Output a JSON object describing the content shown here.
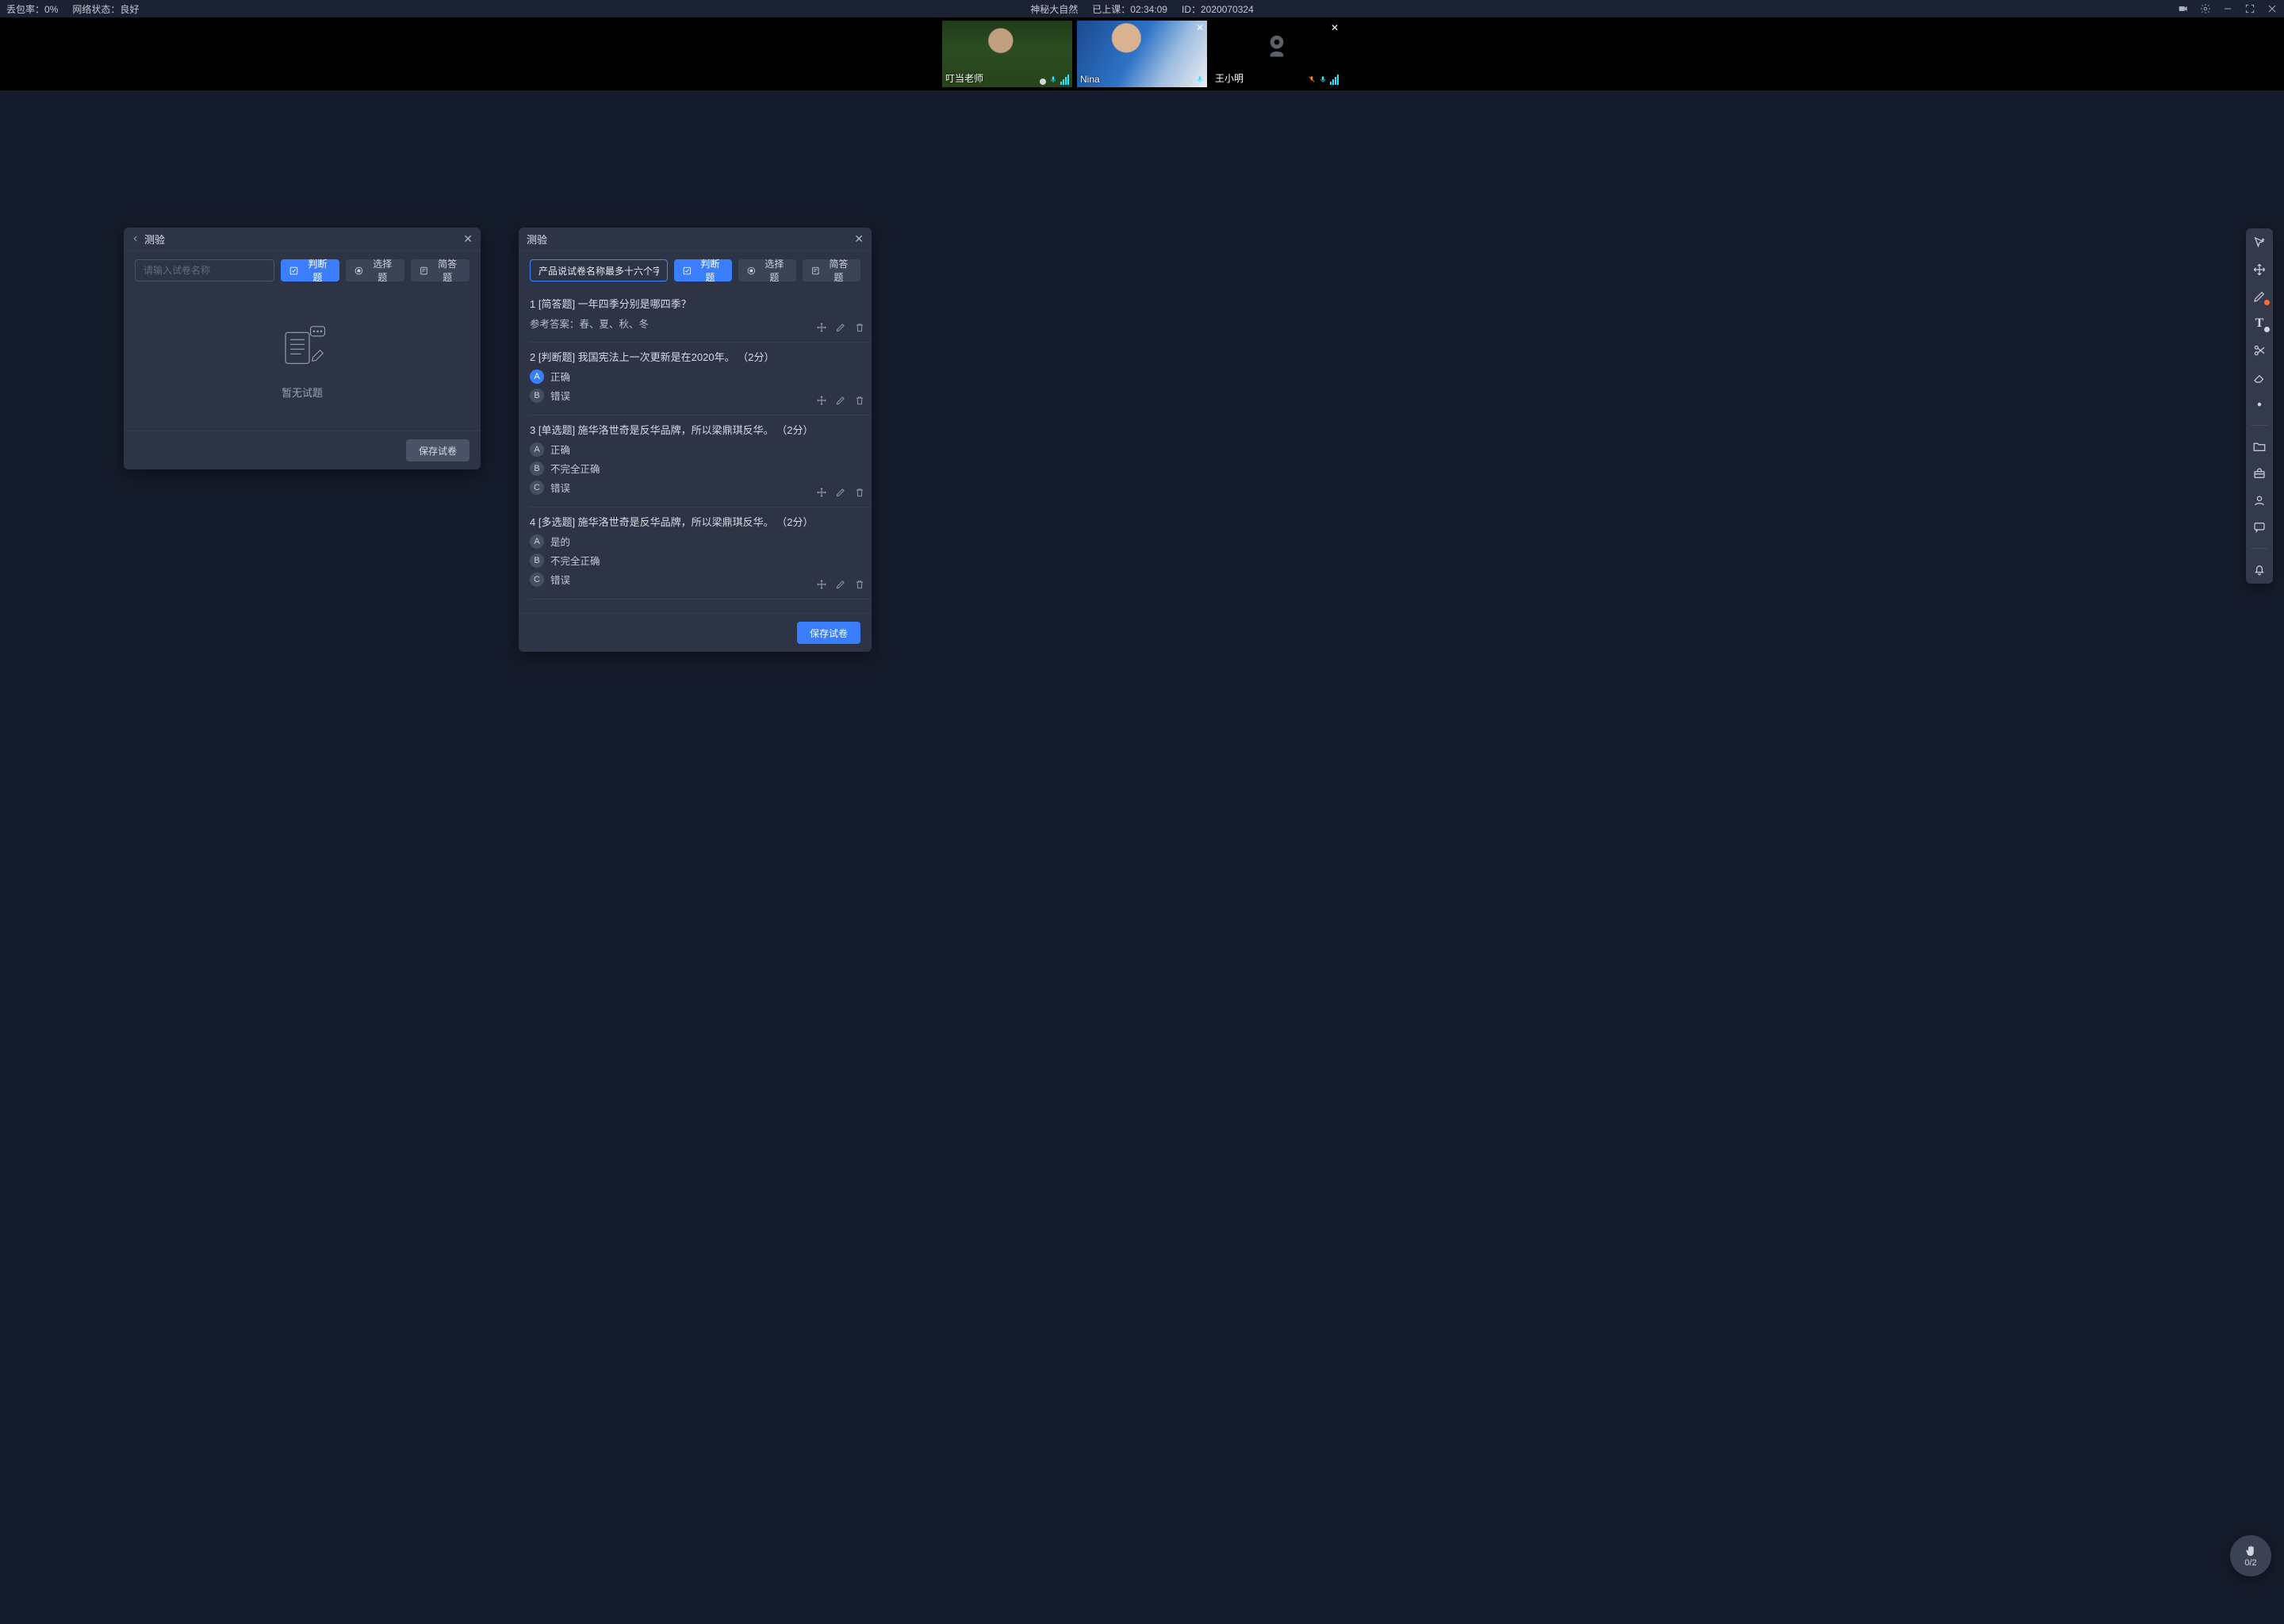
{
  "topbar": {
    "loss_label": "丢包率：",
    "loss_value": "0%",
    "net_label": "网络状态：",
    "net_value": "良好",
    "title": "神秘大自然",
    "elapsed_label": "已上课：",
    "elapsed_value": "02:34:09",
    "id_label": "ID：",
    "id_value": "2020070324"
  },
  "videos": [
    {
      "name": "叮当老师",
      "closable": false,
      "camera_off": false,
      "mic_color": "#2ae6ff",
      "portrait": "p-teacher"
    },
    {
      "name": "Nina",
      "closable": true,
      "camera_off": false,
      "mic_color": "#2ae6ff",
      "portrait": "p-nina"
    },
    {
      "name": "王小明",
      "closable": true,
      "camera_off": true,
      "mic_color": "#2ae6ff"
    }
  ],
  "panel_left": {
    "title": "测验",
    "placeholder": "请输入试卷名称",
    "buttons": {
      "judge": "判断题",
      "choice": "选择题",
      "short": "简答题"
    },
    "empty": "暂无试题",
    "save": "保存试卷"
  },
  "panel_right": {
    "title": "测验",
    "name_value": "产品说试卷名称最多十六个字",
    "buttons": {
      "judge": "判断题",
      "choice": "选择题",
      "short": "简答题"
    },
    "save": "保存试卷",
    "ref_label": "参考答案：",
    "questions": [
      {
        "idx": "1",
        "tag": "[简答题]",
        "text": "一年四季分别是哪四季？",
        "ref": "春、夏、秋、冬"
      },
      {
        "idx": "2",
        "tag": "[判断题]",
        "text": "我国宪法上一次更新是在2020年。 （2分）",
        "options": [
          {
            "letter": "A",
            "text": "正确",
            "correct": true
          },
          {
            "letter": "B",
            "text": "错误"
          }
        ]
      },
      {
        "idx": "3",
        "tag": "[单选题]",
        "text": "施华洛世奇是反华品牌，所以梁鼎琪反华。 （2分）",
        "options": [
          {
            "letter": "A",
            "text": "正确"
          },
          {
            "letter": "B",
            "text": "不完全正确"
          },
          {
            "letter": "C",
            "text": "错误"
          }
        ]
      },
      {
        "idx": "4",
        "tag": "[多选题]",
        "text": "施华洛世奇是反华品牌，所以梁鼎琪反华。 （2分）",
        "options": [
          {
            "letter": "A",
            "text": "是的"
          },
          {
            "letter": "B",
            "text": "不完全正确"
          },
          {
            "letter": "C",
            "text": "错误"
          }
        ]
      }
    ]
  },
  "hand": {
    "count": "0/2"
  },
  "toolbar_icons": {
    "cursor": "cursor-sparkle-icon",
    "move": "move-icon",
    "pen": "pen-icon",
    "text": "text-tool-icon",
    "scissors": "scissors-icon",
    "eraser": "eraser-icon",
    "dot": "color-dot-icon",
    "folder": "folder-icon",
    "toolbox": "toolbox-icon",
    "user": "user-icon",
    "chat": "chat-icon",
    "bell": "bell-icon"
  }
}
